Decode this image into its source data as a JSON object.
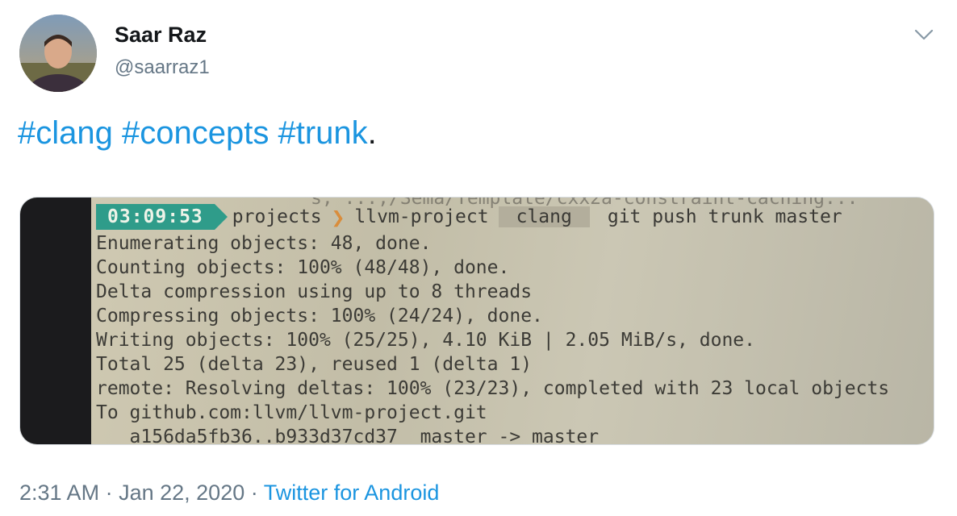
{
  "author": {
    "name": "Saar Raz",
    "handle": "@saarraz1"
  },
  "tweet": {
    "hashtags": [
      "#clang",
      "#concepts",
      "#trunk"
    ],
    "trailing": "."
  },
  "media": {
    "terminal": {
      "cut_top": "s, ...;/Sema/Template/cxx2a-constraint-caching...",
      "time": "03:09:53",
      "path": [
        "projects",
        "llvm-project",
        "clang"
      ],
      "command": "git push trunk master",
      "lines": [
        "Enumerating objects: 48, done.",
        "Counting objects: 100% (48/48), done.",
        "Delta compression using up to 8 threads",
        "Compressing objects: 100% (24/24), done.",
        "Writing objects: 100% (25/25), 4.10 KiB | 2.05 MiB/s, done.",
        "Total 25 (delta 23), reused 1 (delta 1)",
        "remote: Resolving deltas: 100% (23/23), completed with 23 local objects",
        "To github.com:llvm/llvm-project.git",
        "   a156da5fb36..b933d37cd37  master -> master"
      ]
    }
  },
  "meta": {
    "time": "2:31 AM",
    "separator": "·",
    "date": "Jan 22, 2020",
    "source": "Twitter for Android"
  },
  "icons": {
    "menu": "chevron-down-icon"
  },
  "colors": {
    "link": "#1b95e0",
    "muted": "#657786",
    "text": "#14171a"
  }
}
